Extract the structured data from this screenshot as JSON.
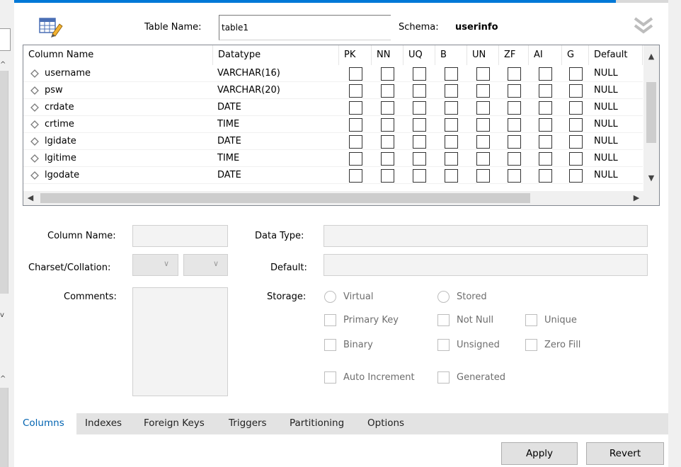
{
  "header": {
    "table_name_label": "Table Name:",
    "table_name_value": "table1",
    "schema_label": "Schema:",
    "schema_value": "userinfo"
  },
  "grid": {
    "columns": [
      "Column Name",
      "Datatype",
      "PK",
      "NN",
      "UQ",
      "B",
      "UN",
      "ZF",
      "AI",
      "G",
      "Default"
    ],
    "rows": [
      {
        "name": "username",
        "type": "VARCHAR(16)",
        "default": "NULL"
      },
      {
        "name": "psw",
        "type": "VARCHAR(20)",
        "default": "NULL"
      },
      {
        "name": "crdate",
        "type": "DATE",
        "default": "NULL"
      },
      {
        "name": "crtime",
        "type": "TIME",
        "default": "NULL"
      },
      {
        "name": "lgidate",
        "type": "DATE",
        "default": "NULL"
      },
      {
        "name": "lgitime",
        "type": "TIME",
        "default": "NULL"
      },
      {
        "name": "lgodate",
        "type": "DATE",
        "default": "NULL"
      }
    ]
  },
  "details": {
    "column_name_label": "Column Name:",
    "charset_label": "Charset/Collation:",
    "comments_label": "Comments:",
    "data_type_label": "Data Type:",
    "default_label": "Default:",
    "storage_label": "Storage:",
    "virtual_label": "Virtual",
    "stored_label": "Stored",
    "primary_key_label": "Primary Key",
    "not_null_label": "Not Null",
    "unique_label": "Unique",
    "binary_label": "Binary",
    "unsigned_label": "Unsigned",
    "zero_fill_label": "Zero Fill",
    "auto_increment_label": "Auto Increment",
    "generated_label": "Generated"
  },
  "tabs": [
    "Columns",
    "Indexes",
    "Foreign Keys",
    "Triggers",
    "Partitioning",
    "Options"
  ],
  "buttons": {
    "apply": "Apply",
    "revert": "Revert"
  },
  "colors": {
    "accent": "#0078d7",
    "active_tab": "#0063b1"
  },
  "icons": {
    "table": "table-icon",
    "collapse": "double-chevron-down-icon",
    "column": "diamond-icon"
  }
}
